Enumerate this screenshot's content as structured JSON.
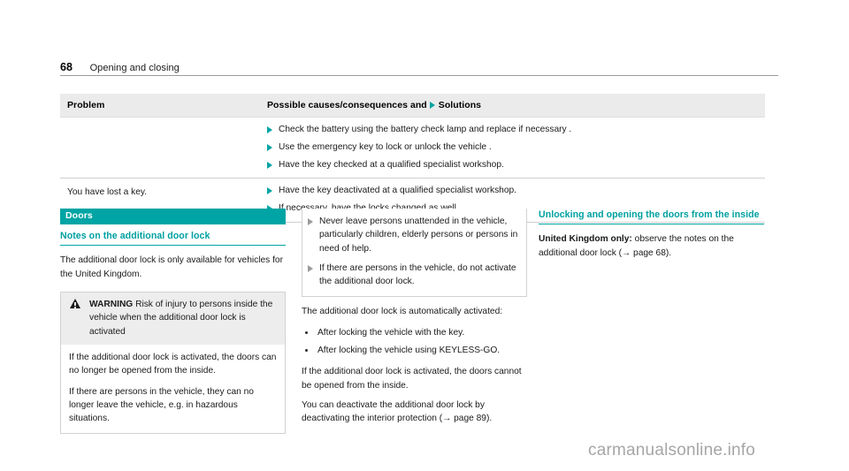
{
  "page": {
    "number": "68",
    "running_title": "Opening and closing",
    "watermark": "carmanualsonline.info"
  },
  "table": {
    "headers": {
      "problem": "Problem",
      "solutions_pre": "Possible causes/consequences and",
      "solutions_post": "Solutions"
    },
    "rows": [
      {
        "problem": "",
        "solutions": [
          "Check the battery using the battery check lamp and replace if necessary .",
          "Use the emergency key to lock or unlock the vehicle .",
          "Have the key checked at a qualified specialist workshop."
        ]
      },
      {
        "problem": "You have lost a key.",
        "solutions": [
          "Have the key deactivated at a qualified specialist workshop.",
          "If necessary, have the locks changed as well."
        ]
      }
    ]
  },
  "column_left": {
    "section_bar": "Doors",
    "subheading": "Notes on the additional door lock",
    "intro": "The additional door lock is only available for vehicles for the United Kingdom.",
    "warning": {
      "label": "WARNING",
      "title": "Risk of injury to persons inside the vehicle when the additional door lock is activated",
      "paragraphs": [
        "If the additional door lock is activated, the doors can no longer be opened from the inside.",
        "If there are persons in the vehicle, they can no longer leave the vehicle, e.g. in hazardous situations."
      ]
    }
  },
  "column_middle": {
    "warning_items": [
      "Never leave persons unattended in the vehicle, particularly children, elderly persons or persons in need of help.",
      "If there are persons in the vehicle, do not activate the additional door lock."
    ],
    "lead_in": "The additional door lock is automatically activated:",
    "bullets": [
      "After locking the vehicle with the key.",
      "After locking the vehicle using KEYLESS-GO."
    ],
    "paragraph_1": "If the additional door lock is activated, the doors cannot be opened from the inside.",
    "paragraph_2_pre": "You can deactivate the additional door lock by deactivating the interior protection (",
    "paragraph_2_ref": "→ page 89",
    "paragraph_2_post": ")."
  },
  "column_right": {
    "heading": "Unlocking and opening the doors from the inside",
    "body_bold": "United Kingdom only:",
    "body_pre": " observe the notes on the additional door lock (",
    "body_ref": "→ page 68",
    "body_post": ")."
  },
  "colors": {
    "teal": "#00a4a4",
    "header_band": "#ebebeb",
    "warning_band": "#ededed"
  }
}
